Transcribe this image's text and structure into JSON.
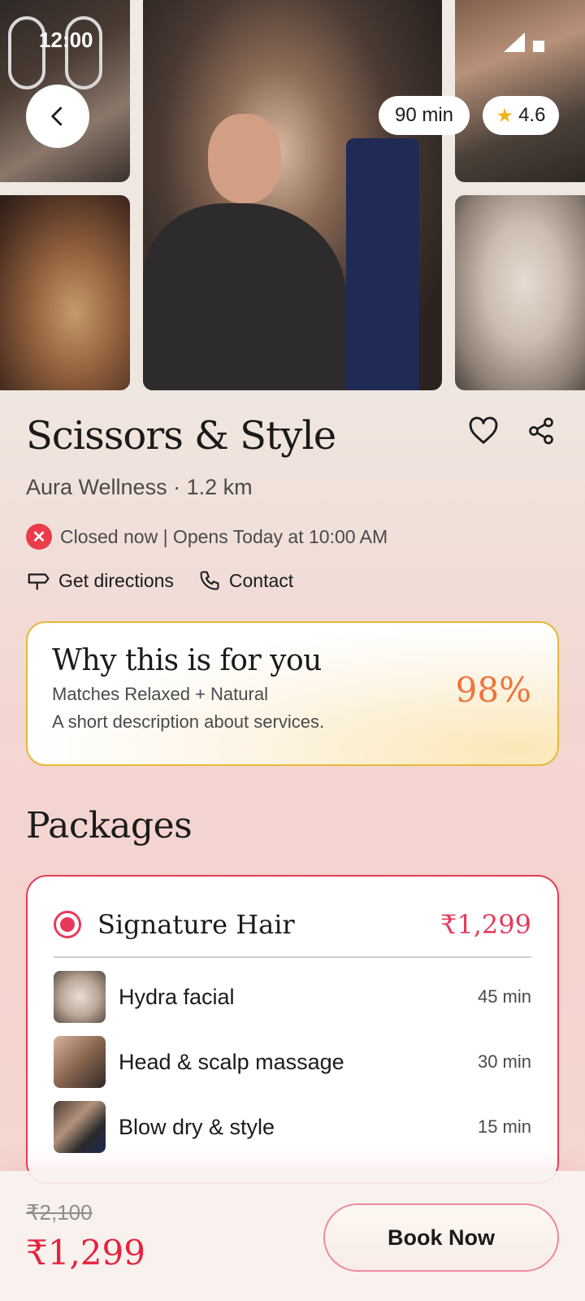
{
  "status_bar": {
    "time": "12:00"
  },
  "gallery": {
    "duration": "90 min",
    "rating": "4.6"
  },
  "salon": {
    "name": "Scissors & Style",
    "subtitle": "Aura Wellness · 1.2 km",
    "status": "Closed now | Opens Today at 10:00 AM",
    "directions_label": "Get directions",
    "contact_label": "Contact"
  },
  "why_card": {
    "title": "Why this is for you",
    "match_line": "Matches Relaxed + Natural",
    "description": "A short description about services.",
    "match_percent": "98%"
  },
  "packages": {
    "title": "Packages",
    "selected": {
      "name": "Signature Hair",
      "price": "₹1,299",
      "services": [
        {
          "name": "Hydra facial",
          "duration": "45 min"
        },
        {
          "name": "Head & scalp massage",
          "duration": "30 min"
        },
        {
          "name": "Blow dry & style",
          "duration": "15 min"
        }
      ]
    }
  },
  "footer": {
    "original_price": "₹2,100",
    "price": "₹1,299",
    "book_label": "Book Now"
  },
  "colors": {
    "accent": "#e63a5a",
    "closed_badge": "#ea3c4a",
    "match_accent": "#f0733a",
    "why_border": "#e6b83a",
    "star": "#f1b21b"
  }
}
